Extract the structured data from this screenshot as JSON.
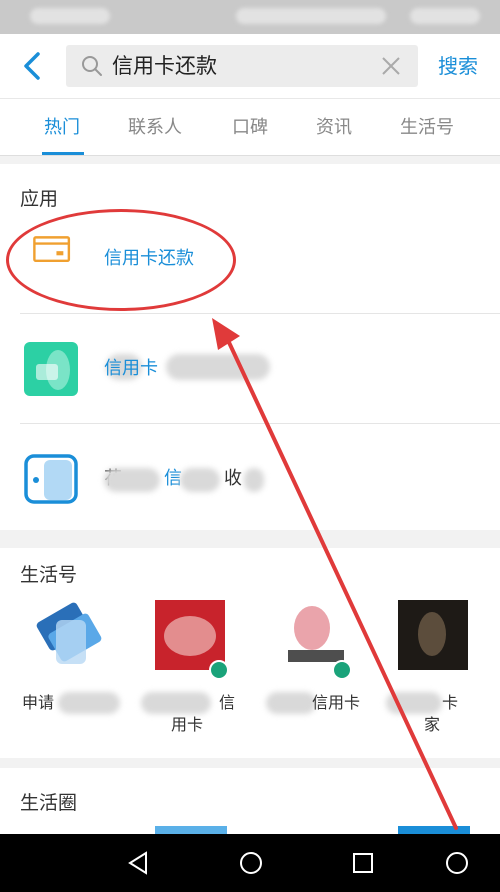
{
  "search": {
    "query": "信用卡还款",
    "submit_label": "搜索"
  },
  "tabs": [
    {
      "label": "热门",
      "active": true
    },
    {
      "label": "联系人"
    },
    {
      "label": "口碑"
    },
    {
      "label": "资讯"
    },
    {
      "label": "生活号"
    }
  ],
  "apps_section": {
    "title": "应用",
    "items": [
      {
        "label": "信用卡还款",
        "icon": "credit-card-icon"
      },
      {
        "label": "信用卡",
        "icon": "app-green-icon"
      },
      {
        "label": "信",
        "prefix": "花",
        "suffix": "收",
        "icon": "app-blue-icon"
      }
    ]
  },
  "life_section": {
    "title": "生活号",
    "items": [
      {
        "name": "申请"
      },
      {
        "name": "信",
        "line2": "用卡"
      },
      {
        "name": "信用卡"
      },
      {
        "name": "卡",
        "line2": "家"
      }
    ]
  },
  "circle_section": {
    "title": "生活圈"
  },
  "colors": {
    "accent": "#1a8ed8",
    "annotation": "#e03a3a"
  }
}
